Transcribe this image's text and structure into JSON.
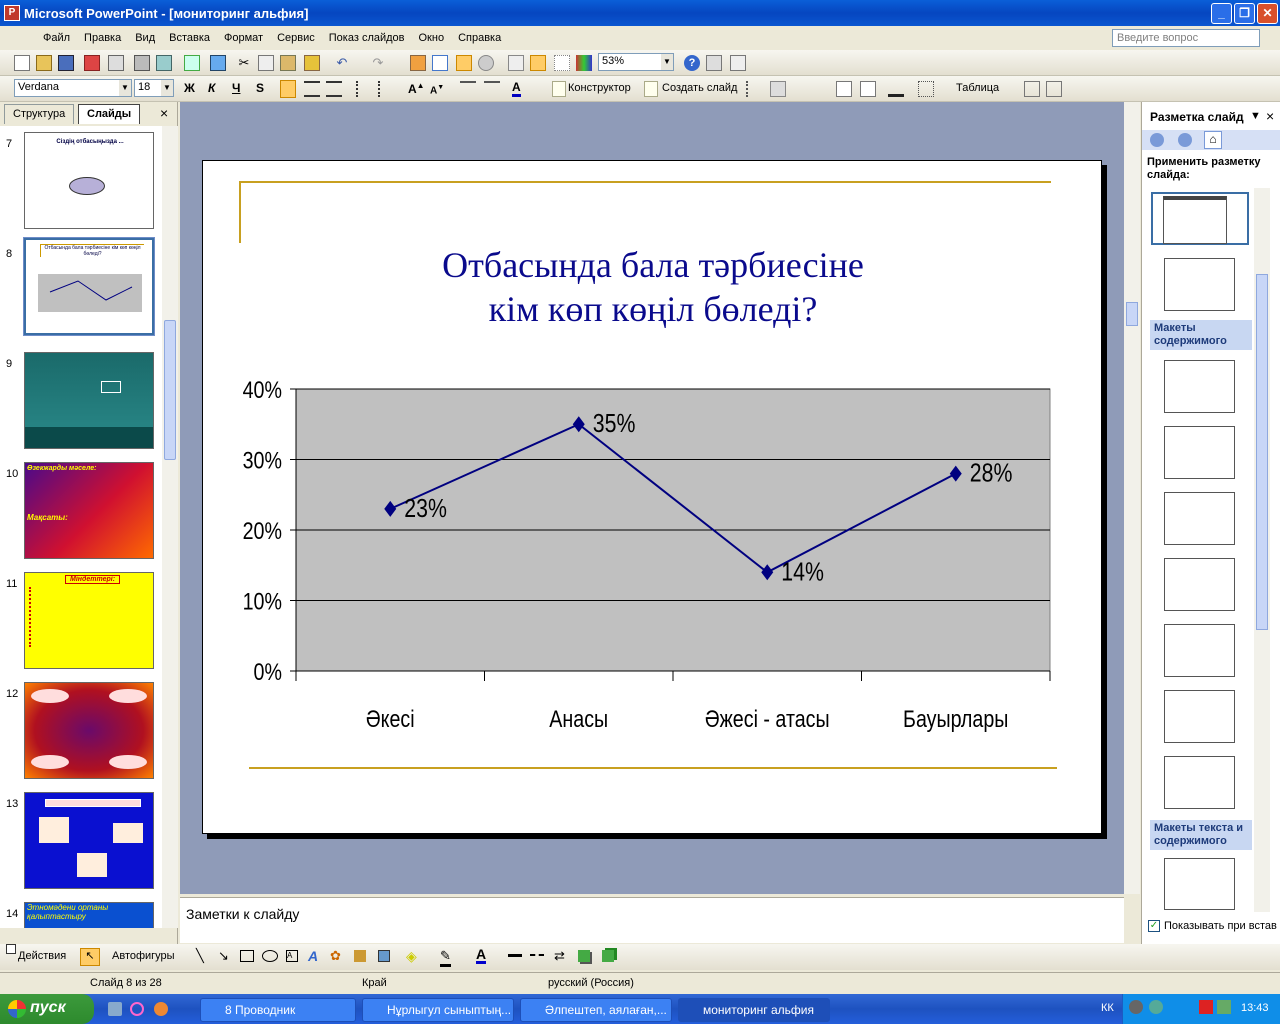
{
  "app": {
    "title": "Microsoft PowerPoint - [мониторинг альфия]",
    "icon_letter": "P"
  },
  "menu": [
    "Файл",
    "Правка",
    "Вид",
    "Вставка",
    "Формат",
    "Сервис",
    "Показ слайдов",
    "Окно",
    "Справка"
  ],
  "help_box": {
    "placeholder": "Введите вопрос"
  },
  "toolbar": {
    "zoom": "53%",
    "font": "Verdana",
    "font_size": "18",
    "bold": "Ж",
    "italic": "К",
    "underline": "Ч",
    "shadow": "S",
    "designer_label": "Конструктор",
    "new_slide_label": "Создать слайд",
    "table_label": "Таблица"
  },
  "left_pane": {
    "tabs": [
      "Структура",
      "Слайды"
    ],
    "close_glyph": "×",
    "slides": [
      {
        "num": "7",
        "title": "Сіздің отбасыңызда ..."
      },
      {
        "num": "8",
        "title": "Отбасында бала тәрбиесіне кім көп көңіл бөледі?"
      },
      {
        "num": "9",
        "title": ""
      },
      {
        "num": "10",
        "title": "Өзекжарды мәселе:",
        "subtitle": "Мақсаты:"
      },
      {
        "num": "11",
        "title": "Міндеттері:"
      },
      {
        "num": "12",
        "title": ""
      },
      {
        "num": "13",
        "title": ""
      },
      {
        "num": "14",
        "title": "Этномәдени ортаны қалыптастыру"
      }
    ]
  },
  "slide": {
    "title_line1": "Отбасында бала тәрбиесіне",
    "title_line2": "кім көп көңіл бөледі?"
  },
  "chart_data": {
    "type": "line",
    "categories": [
      "Әкесі",
      "Анасы",
      "Әжесі - атасы",
      "Бауырлары"
    ],
    "values": [
      23,
      35,
      14,
      28
    ],
    "value_labels": [
      "23%",
      "35%",
      "14%",
      "28%"
    ],
    "y_ticks": [
      "0%",
      "10%",
      "20%",
      "30%",
      "40%"
    ],
    "ylim": [
      0,
      40
    ],
    "grid": true,
    "line_color": "#000080",
    "plot_bg": "#c0c0c0"
  },
  "notes": {
    "placeholder": "Заметки к слайду"
  },
  "task_pane": {
    "title": "Разметка слайд",
    "apply_label": "Применить разметку слайда:",
    "section_content": "Макеты содержимого",
    "section_text_content": "Макеты текста и содержимого",
    "show_on_insert": "Показывать при встав"
  },
  "drawing_bar": {
    "actions": "Действия",
    "autoshapes": "Автофигуры"
  },
  "status": {
    "slide": "Слайд 8 из 28",
    "design": "Край",
    "language": "русский (Россия)"
  },
  "taskbar": {
    "start": "пуск",
    "tasks": [
      "8 Проводник",
      "Нұрлыгул сыныптың...",
      "Әлпештеп, аялаған,...",
      "мониторинг альфия"
    ],
    "lang": "КК",
    "clock": "13:43"
  }
}
